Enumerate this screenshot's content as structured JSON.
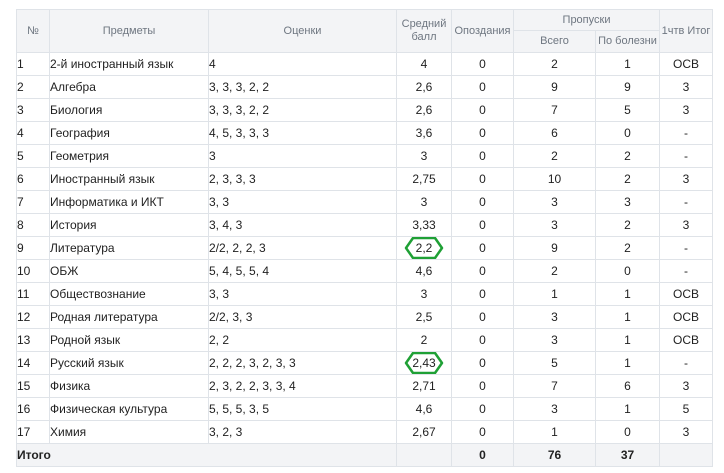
{
  "headers": {
    "num": "№",
    "subject": "Предметы",
    "grades": "Оценки",
    "avg": "Средний балл",
    "late": "Опоздания",
    "absences": "Пропуски",
    "abs_total": "Всего",
    "abs_sick": "По болезни",
    "final": "1чтв Итог"
  },
  "rows": [
    {
      "num": "1",
      "subject": "2-й иностранный язык",
      "grades": "4",
      "avg": "4",
      "late": "0",
      "total": "2",
      "sick": "1",
      "final": "ОСВ"
    },
    {
      "num": "2",
      "subject": "Алгебра",
      "grades": "3, 3, 3, 2, 2",
      "avg": "2,6",
      "late": "0",
      "total": "9",
      "sick": "9",
      "final": "3"
    },
    {
      "num": "3",
      "subject": "Биология",
      "grades": "3, 3, 3, 2, 2",
      "avg": "2,6",
      "late": "0",
      "total": "7",
      "sick": "5",
      "final": "3"
    },
    {
      "num": "4",
      "subject": "География",
      "grades": "4, 5, 3, 3, 3",
      "avg": "3,6",
      "late": "0",
      "total": "6",
      "sick": "0",
      "final": "-"
    },
    {
      "num": "5",
      "subject": "Геометрия",
      "grades": "3",
      "avg": "3",
      "late": "0",
      "total": "2",
      "sick": "2",
      "final": "-"
    },
    {
      "num": "6",
      "subject": "Иностранный язык",
      "grades": "2, 3, 3, 3",
      "avg": "2,75",
      "late": "0",
      "total": "10",
      "sick": "2",
      "final": "3"
    },
    {
      "num": "7",
      "subject": "Информатика и ИКТ",
      "grades": "3, 3",
      "avg": "3",
      "late": "0",
      "total": "3",
      "sick": "3",
      "final": "-"
    },
    {
      "num": "8",
      "subject": "История",
      "grades": "3, 4, 3",
      "avg": "3,33",
      "late": "0",
      "total": "3",
      "sick": "2",
      "final": "3"
    },
    {
      "num": "9",
      "subject": "Литература",
      "grades": "2/2, 2, 2, 3",
      "avg": "2,2",
      "late": "0",
      "total": "9",
      "sick": "2",
      "final": "-"
    },
    {
      "num": "10",
      "subject": "ОБЖ",
      "grades": "5, 4, 5, 5, 4",
      "avg": "4,6",
      "late": "0",
      "total": "2",
      "sick": "0",
      "final": "-"
    },
    {
      "num": "11",
      "subject": "Обществознание",
      "grades": "3, 3",
      "avg": "3",
      "late": "0",
      "total": "1",
      "sick": "1",
      "final": "ОСВ"
    },
    {
      "num": "12",
      "subject": "Родная литература",
      "grades": "2/2, 3, 3",
      "avg": "2,5",
      "late": "0",
      "total": "3",
      "sick": "1",
      "final": "ОСВ"
    },
    {
      "num": "13",
      "subject": "Родной язык",
      "grades": "2, 2",
      "avg": "2",
      "late": "0",
      "total": "3",
      "sick": "1",
      "final": "ОСВ"
    },
    {
      "num": "14",
      "subject": "Русский язык",
      "grades": "2, 2, 2, 3, 2, 3, 3",
      "avg": "2,43",
      "late": "0",
      "total": "5",
      "sick": "1",
      "final": "-"
    },
    {
      "num": "15",
      "subject": "Физика",
      "grades": "2, 3, 2, 2, 3, 3, 4",
      "avg": "2,71",
      "late": "0",
      "total": "7",
      "sick": "6",
      "final": "3"
    },
    {
      "num": "16",
      "subject": "Физическая культура",
      "grades": "5, 5, 5, 3, 5",
      "avg": "4,6",
      "late": "0",
      "total": "3",
      "sick": "1",
      "final": "5"
    },
    {
      "num": "17",
      "subject": "Химия",
      "grades": "3, 2, 3",
      "avg": "2,67",
      "late": "0",
      "total": "1",
      "sick": "0",
      "final": "3"
    }
  ],
  "totals": {
    "label": "Итого",
    "late": "0",
    "total": "76",
    "sick": "37"
  },
  "highlight": {
    "color": "#1fa035",
    "rows": [
      "9",
      "14"
    ]
  }
}
